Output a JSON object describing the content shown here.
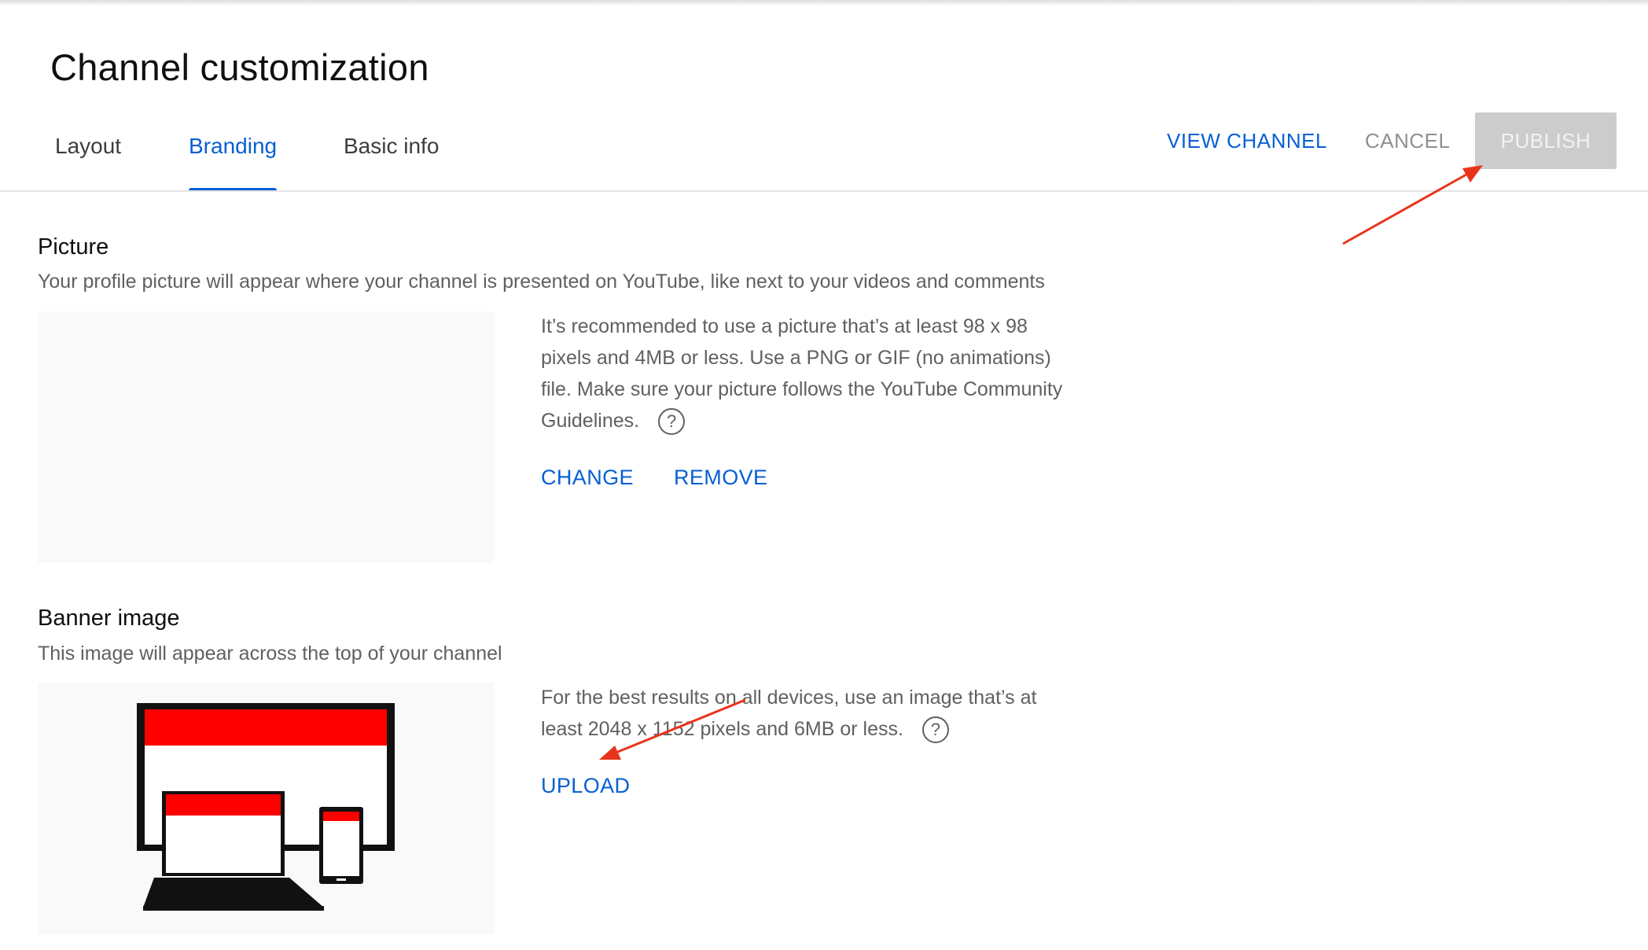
{
  "page": {
    "title": "Channel customization"
  },
  "tabs": [
    {
      "label": "Layout",
      "active": false
    },
    {
      "label": "Branding",
      "active": true
    },
    {
      "label": "Basic info",
      "active": false
    }
  ],
  "header_actions": {
    "view_channel": "VIEW CHANNEL",
    "cancel": "CANCEL",
    "publish": "PUBLISH"
  },
  "picture": {
    "title": "Picture",
    "description": "Your profile picture will appear where your channel is presented on YouTube, like next to your videos and comments",
    "info": "It’s recommended to use a picture that’s at least 98 x 98 pixels and 4MB or less. Use a PNG or GIF (no animations) file. Make sure your picture follows the YouTube Community Guidelines.",
    "help_glyph": "?",
    "change": "CHANGE",
    "remove": "REMOVE"
  },
  "banner": {
    "title": "Banner image",
    "description": "This image will appear across the top of your channel",
    "info": "For the best results on all devices, use an image that’s at least 2048 x 1152 pixels and 6MB or less.",
    "help_glyph": "?",
    "upload": "UPLOAD"
  },
  "colors": {
    "accent_blue": "#065fd4",
    "annotation_red": "#e8341c",
    "banner_red": "#ff0000"
  },
  "icons": {
    "help": "help-circle-icon",
    "devices": "devices-illustration-icon",
    "arrow": "annotation-arrow-icon"
  }
}
